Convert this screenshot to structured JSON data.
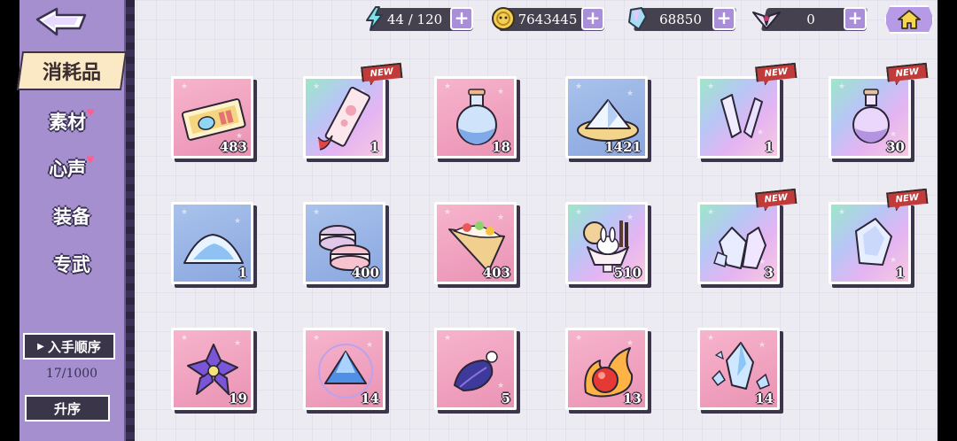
{
  "sidebar": {
    "tabs": [
      {
        "label": "消耗品",
        "active": true
      },
      {
        "label": "素材",
        "active": false
      },
      {
        "label": "心声",
        "active": false
      },
      {
        "label": "装备",
        "active": false
      },
      {
        "label": "专武",
        "active": false
      }
    ],
    "sort_label": "入手顺序",
    "count_text": "17/1000",
    "order_label": "升序"
  },
  "topbar": {
    "stamina": {
      "value": "44 / 120",
      "icon": "lightning-icon"
    },
    "gold": {
      "value": "7643445",
      "icon": "coin-icon"
    },
    "gems": {
      "value": "68850",
      "icon": "crystal-icon"
    },
    "emblem": {
      "value": "0",
      "icon": "wing-emblem-icon"
    },
    "plus_label": "+"
  },
  "new_label": "NEW",
  "items": [
    {
      "name": "ticket",
      "qty": "483",
      "bg": "pink",
      "new": false
    },
    {
      "name": "paper-charm",
      "qty": "1",
      "bg": "rainbow",
      "new": true
    },
    {
      "name": "potion-flask",
      "qty": "18",
      "bg": "pink",
      "new": false
    },
    {
      "name": "crystal-mound",
      "qty": "1421",
      "bg": "blue",
      "new": false
    },
    {
      "name": "crystal-shards",
      "qty": "1",
      "bg": "rainbow",
      "new": true
    },
    {
      "name": "purple-potion",
      "qty": "30",
      "bg": "rainbow",
      "new": true
    },
    {
      "name": "blue-powder",
      "qty": "1",
      "bg": "blue",
      "new": false
    },
    {
      "name": "macaron",
      "qty": "400",
      "bg": "blue",
      "new": false
    },
    {
      "name": "crepe",
      "qty": "403",
      "bg": "pink",
      "new": false
    },
    {
      "name": "parfait",
      "qty": "510",
      "bg": "rainbow",
      "new": false
    },
    {
      "name": "crystal-cluster",
      "qty": "3",
      "bg": "rainbow",
      "new": true
    },
    {
      "name": "crystal-prism",
      "qty": "1",
      "bg": "rainbow",
      "new": true
    },
    {
      "name": "violet-flower",
      "qty": "19",
      "bg": "pink",
      "new": false
    },
    {
      "name": "blue-gem-triangle",
      "qty": "14",
      "bg": "pink",
      "new": false
    },
    {
      "name": "dark-feather",
      "qty": "5",
      "bg": "pink",
      "new": false
    },
    {
      "name": "fire-orb",
      "qty": "13",
      "bg": "pink",
      "new": false
    },
    {
      "name": "ice-crystal-shards",
      "qty": "14",
      "bg": "pink",
      "new": false
    }
  ]
}
